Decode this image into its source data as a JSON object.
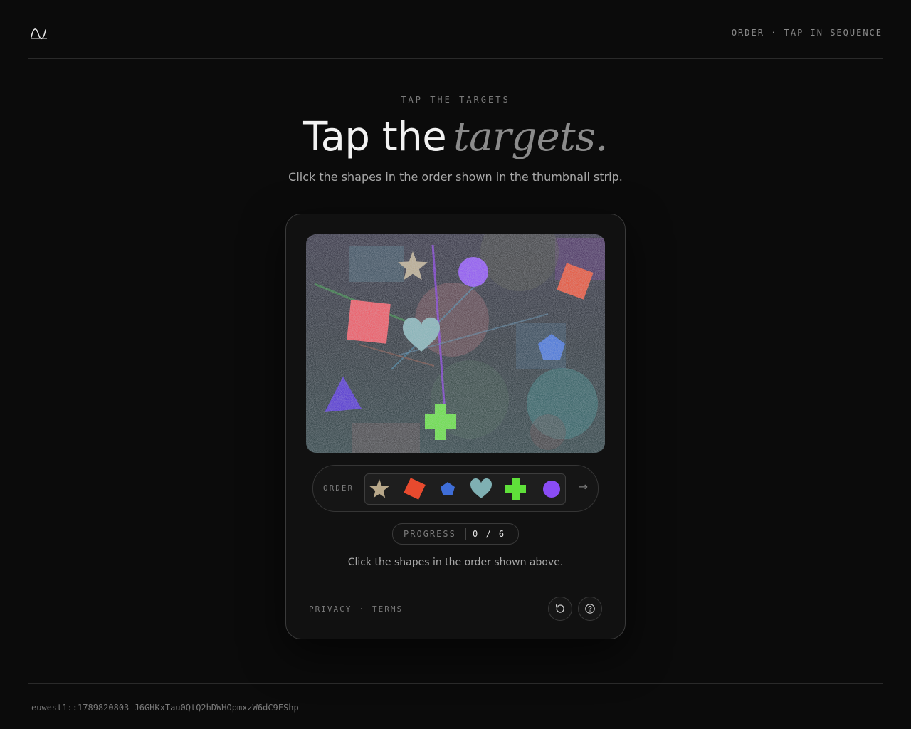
{
  "header": {
    "top_right": "ORDER · TAP IN SEQUENCE",
    "logo_icon": "wave-logo-icon"
  },
  "hero": {
    "eyebrow": "TAP THE TARGETS",
    "headline_plain": "Tap the",
    "headline_accent": "targets.",
    "subtitle": "Click the shapes in the order shown in the thumbnail strip."
  },
  "challenge": {
    "canvas_shapes": [
      {
        "name": "star",
        "color": "#b8a88a"
      },
      {
        "name": "circle",
        "color": "#8a4cf5"
      },
      {
        "name": "square",
        "color": "#e84a2e"
      },
      {
        "name": "square",
        "color": "#f0505a"
      },
      {
        "name": "heart",
        "color": "#7fb0b3"
      },
      {
        "name": "pentagon",
        "color": "#3f6ed8"
      },
      {
        "name": "triangle",
        "color": "#4a2ad0"
      },
      {
        "name": "cross",
        "color": "#5fe03a"
      }
    ],
    "order_label": "ORDER",
    "order_thumbnails": [
      {
        "name": "star",
        "color": "#b8a88a"
      },
      {
        "name": "diamond",
        "color": "#e84a2e"
      },
      {
        "name": "pentagon",
        "color": "#3f6ed8"
      },
      {
        "name": "heart",
        "color": "#7fb0b3"
      },
      {
        "name": "cross",
        "color": "#5fe03a"
      },
      {
        "name": "circle",
        "color": "#8a4cf5"
      }
    ],
    "order_arrow": "→",
    "progress_label": "PROGRESS",
    "progress_value": "0 / 6",
    "progress_current": 0,
    "progress_total": 6,
    "instruction": "Click the shapes in the order shown above."
  },
  "card_footer": {
    "privacy": "PRIVACY",
    "sep": "·",
    "terms": "TERMS",
    "reload_icon": "reload-icon",
    "help_icon": "help-icon"
  },
  "footer": {
    "request_id": "euwest1::1789820803-J6GHKxTau0QtQ2hDWHOpmxzW6dC9FShp"
  },
  "colors": {
    "background": "#0b0b0b",
    "card": "#111111",
    "border": "#3a3a3a",
    "text": "#f2f2f2",
    "muted": "#7a7a7a"
  }
}
